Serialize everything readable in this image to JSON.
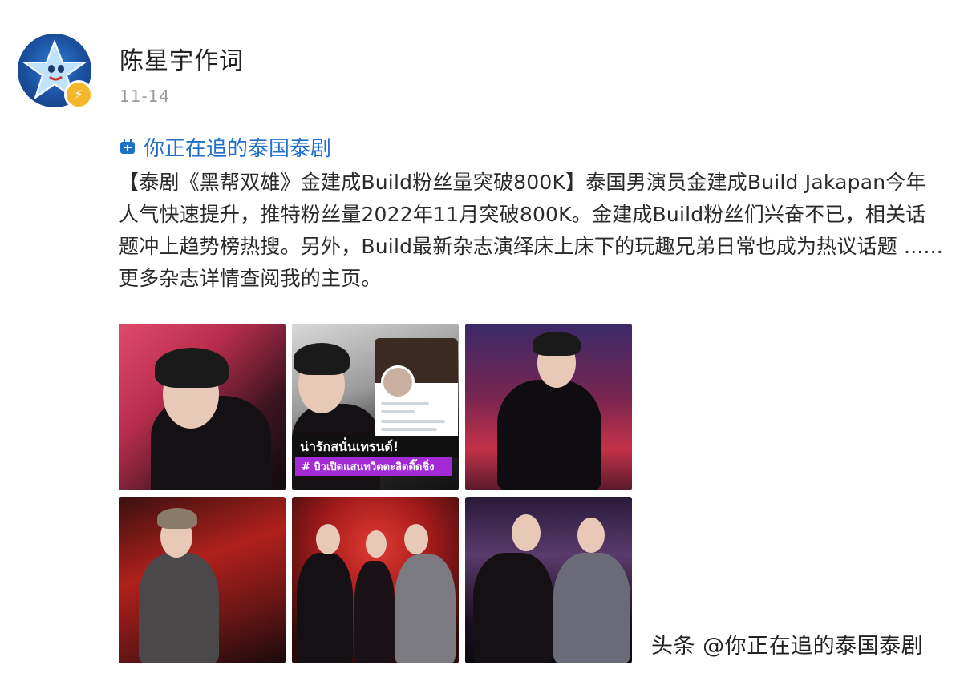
{
  "post": {
    "username": "陈星宇作词",
    "date": "11-14",
    "topic": "你正在追的泰国泰剧",
    "text": "【泰剧《黑帮双雄》金建成Build粉丝量突破800K】泰国男演员金建成Build Jakapan今年人气快速提升，推特粉丝量2022年11月突破800K。金建成Build粉丝们兴奋不已，相关话题冲上趋势榜热搜。另外，Build最新杂志演绎床上床下的玩趣兄弟日常也成为热议话题 ...... 更多杂志详情查阅我的主页。",
    "badge_icon": "lightning-icon",
    "avatar_icon": "star-icon"
  },
  "gallery": {
    "photo2_banner_line1": "น่ารักสนั่นเทรนด์!",
    "photo2_banner_line2": "# บิวเปิดแสนทวิตตะลิตติ๊ดชิ่ง"
  },
  "watermark": "头条 @你正在追的泰国泰剧",
  "colors": {
    "topic_link": "#1f6fcc",
    "date_gray": "#9a9a9a",
    "badge": "#f5b82a",
    "thai_banner_purple": "#a22bd6"
  }
}
